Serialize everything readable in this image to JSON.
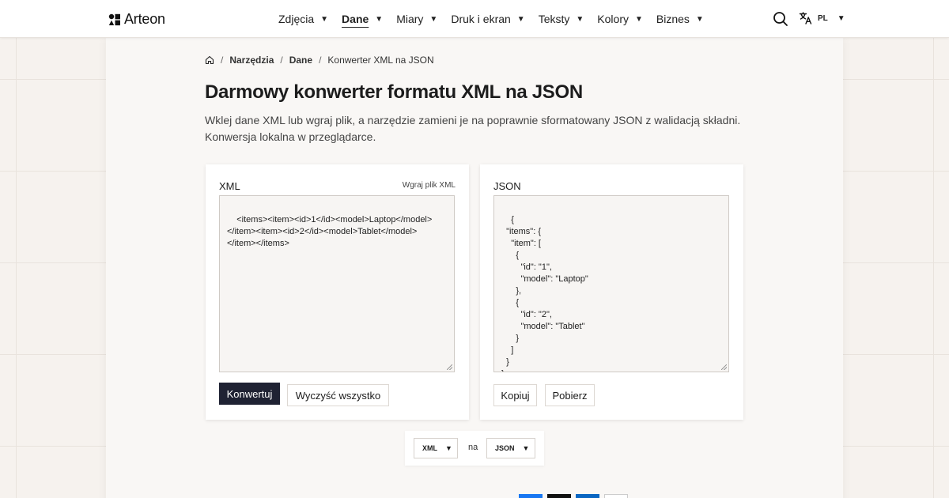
{
  "brand": {
    "name": "Arteon"
  },
  "nav": [
    {
      "label": "Zdjęcia",
      "active": false
    },
    {
      "label": "Dane",
      "active": true
    },
    {
      "label": "Miary",
      "active": false
    },
    {
      "label": "Druk i ekran",
      "active": false
    },
    {
      "label": "Teksty",
      "active": false
    },
    {
      "label": "Kolory",
      "active": false
    },
    {
      "label": "Biznes",
      "active": false
    }
  ],
  "header": {
    "lang_code": "PL",
    "search_icon": "search-icon",
    "lang_icon": "translate-icon"
  },
  "breadcrumb": {
    "home_icon": "home-icon",
    "items": [
      "Narzędzia",
      "Dane",
      "Konwerter XML na JSON"
    ]
  },
  "page": {
    "title": "Darmowy konwerter formatu XML na JSON",
    "description": "Wklej dane XML lub wgraj plik, a narzędzie zamieni je na poprawnie sformatowany JSON z walidacją składni. Konwersja lokalna w przeglądarce."
  },
  "xml_panel": {
    "label": "XML",
    "upload_label": "Wgraj plik XML",
    "value": "<items><item><id>1</id><model>Laptop</model>\n</item><item><id>2</id><model>Tablet</model>\n</item></items>",
    "convert_button": "Konwertuj",
    "clear_button": "Wyczyść wszystko"
  },
  "json_panel": {
    "label": "JSON",
    "value": "{\n  \"items\": {\n    \"item\": [\n      {\n        \"id\": \"1\",\n        \"model\": \"Laptop\"\n      },\n      {\n        \"id\": \"2\",\n        \"model\": \"Tablet\"\n      }\n    ]\n  }\n}",
    "copy_button": "Kopiuj",
    "download_button": "Pobierz"
  },
  "format_selector": {
    "from": "XML",
    "to_label": "na",
    "to": "JSON"
  },
  "colors": {
    "primary_button": "#1f2233",
    "background": "#f6f2ee"
  }
}
